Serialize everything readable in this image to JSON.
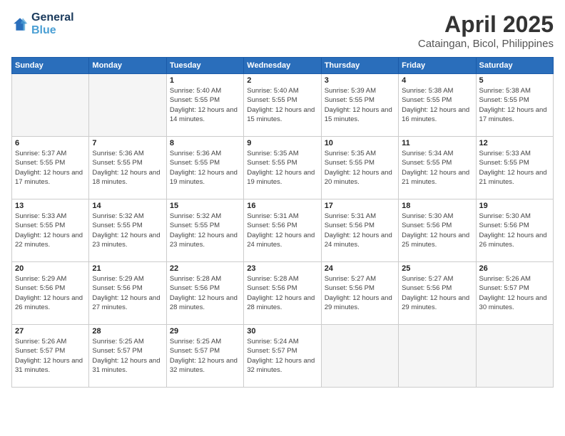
{
  "logo": {
    "line1": "General",
    "line2": "Blue"
  },
  "title": "April 2025",
  "subtitle": "Cataingan, Bicol, Philippines",
  "days_header": [
    "Sunday",
    "Monday",
    "Tuesday",
    "Wednesday",
    "Thursday",
    "Friday",
    "Saturday"
  ],
  "weeks": [
    [
      {
        "day": "",
        "info": ""
      },
      {
        "day": "",
        "info": ""
      },
      {
        "day": "1",
        "info": "Sunrise: 5:40 AM\nSunset: 5:55 PM\nDaylight: 12 hours and 14 minutes."
      },
      {
        "day": "2",
        "info": "Sunrise: 5:40 AM\nSunset: 5:55 PM\nDaylight: 12 hours and 15 minutes."
      },
      {
        "day": "3",
        "info": "Sunrise: 5:39 AM\nSunset: 5:55 PM\nDaylight: 12 hours and 15 minutes."
      },
      {
        "day": "4",
        "info": "Sunrise: 5:38 AM\nSunset: 5:55 PM\nDaylight: 12 hours and 16 minutes."
      },
      {
        "day": "5",
        "info": "Sunrise: 5:38 AM\nSunset: 5:55 PM\nDaylight: 12 hours and 17 minutes."
      }
    ],
    [
      {
        "day": "6",
        "info": "Sunrise: 5:37 AM\nSunset: 5:55 PM\nDaylight: 12 hours and 17 minutes."
      },
      {
        "day": "7",
        "info": "Sunrise: 5:36 AM\nSunset: 5:55 PM\nDaylight: 12 hours and 18 minutes."
      },
      {
        "day": "8",
        "info": "Sunrise: 5:36 AM\nSunset: 5:55 PM\nDaylight: 12 hours and 19 minutes."
      },
      {
        "day": "9",
        "info": "Sunrise: 5:35 AM\nSunset: 5:55 PM\nDaylight: 12 hours and 19 minutes."
      },
      {
        "day": "10",
        "info": "Sunrise: 5:35 AM\nSunset: 5:55 PM\nDaylight: 12 hours and 20 minutes."
      },
      {
        "day": "11",
        "info": "Sunrise: 5:34 AM\nSunset: 5:55 PM\nDaylight: 12 hours and 21 minutes."
      },
      {
        "day": "12",
        "info": "Sunrise: 5:33 AM\nSunset: 5:55 PM\nDaylight: 12 hours and 21 minutes."
      }
    ],
    [
      {
        "day": "13",
        "info": "Sunrise: 5:33 AM\nSunset: 5:55 PM\nDaylight: 12 hours and 22 minutes."
      },
      {
        "day": "14",
        "info": "Sunrise: 5:32 AM\nSunset: 5:55 PM\nDaylight: 12 hours and 23 minutes."
      },
      {
        "day": "15",
        "info": "Sunrise: 5:32 AM\nSunset: 5:55 PM\nDaylight: 12 hours and 23 minutes."
      },
      {
        "day": "16",
        "info": "Sunrise: 5:31 AM\nSunset: 5:56 PM\nDaylight: 12 hours and 24 minutes."
      },
      {
        "day": "17",
        "info": "Sunrise: 5:31 AM\nSunset: 5:56 PM\nDaylight: 12 hours and 24 minutes."
      },
      {
        "day": "18",
        "info": "Sunrise: 5:30 AM\nSunset: 5:56 PM\nDaylight: 12 hours and 25 minutes."
      },
      {
        "day": "19",
        "info": "Sunrise: 5:30 AM\nSunset: 5:56 PM\nDaylight: 12 hours and 26 minutes."
      }
    ],
    [
      {
        "day": "20",
        "info": "Sunrise: 5:29 AM\nSunset: 5:56 PM\nDaylight: 12 hours and 26 minutes."
      },
      {
        "day": "21",
        "info": "Sunrise: 5:29 AM\nSunset: 5:56 PM\nDaylight: 12 hours and 27 minutes."
      },
      {
        "day": "22",
        "info": "Sunrise: 5:28 AM\nSunset: 5:56 PM\nDaylight: 12 hours and 28 minutes."
      },
      {
        "day": "23",
        "info": "Sunrise: 5:28 AM\nSunset: 5:56 PM\nDaylight: 12 hours and 28 minutes."
      },
      {
        "day": "24",
        "info": "Sunrise: 5:27 AM\nSunset: 5:56 PM\nDaylight: 12 hours and 29 minutes."
      },
      {
        "day": "25",
        "info": "Sunrise: 5:27 AM\nSunset: 5:56 PM\nDaylight: 12 hours and 29 minutes."
      },
      {
        "day": "26",
        "info": "Sunrise: 5:26 AM\nSunset: 5:57 PM\nDaylight: 12 hours and 30 minutes."
      }
    ],
    [
      {
        "day": "27",
        "info": "Sunrise: 5:26 AM\nSunset: 5:57 PM\nDaylight: 12 hours and 31 minutes."
      },
      {
        "day": "28",
        "info": "Sunrise: 5:25 AM\nSunset: 5:57 PM\nDaylight: 12 hours and 31 minutes."
      },
      {
        "day": "29",
        "info": "Sunrise: 5:25 AM\nSunset: 5:57 PM\nDaylight: 12 hours and 32 minutes."
      },
      {
        "day": "30",
        "info": "Sunrise: 5:24 AM\nSunset: 5:57 PM\nDaylight: 12 hours and 32 minutes."
      },
      {
        "day": "",
        "info": ""
      },
      {
        "day": "",
        "info": ""
      },
      {
        "day": "",
        "info": ""
      }
    ]
  ]
}
